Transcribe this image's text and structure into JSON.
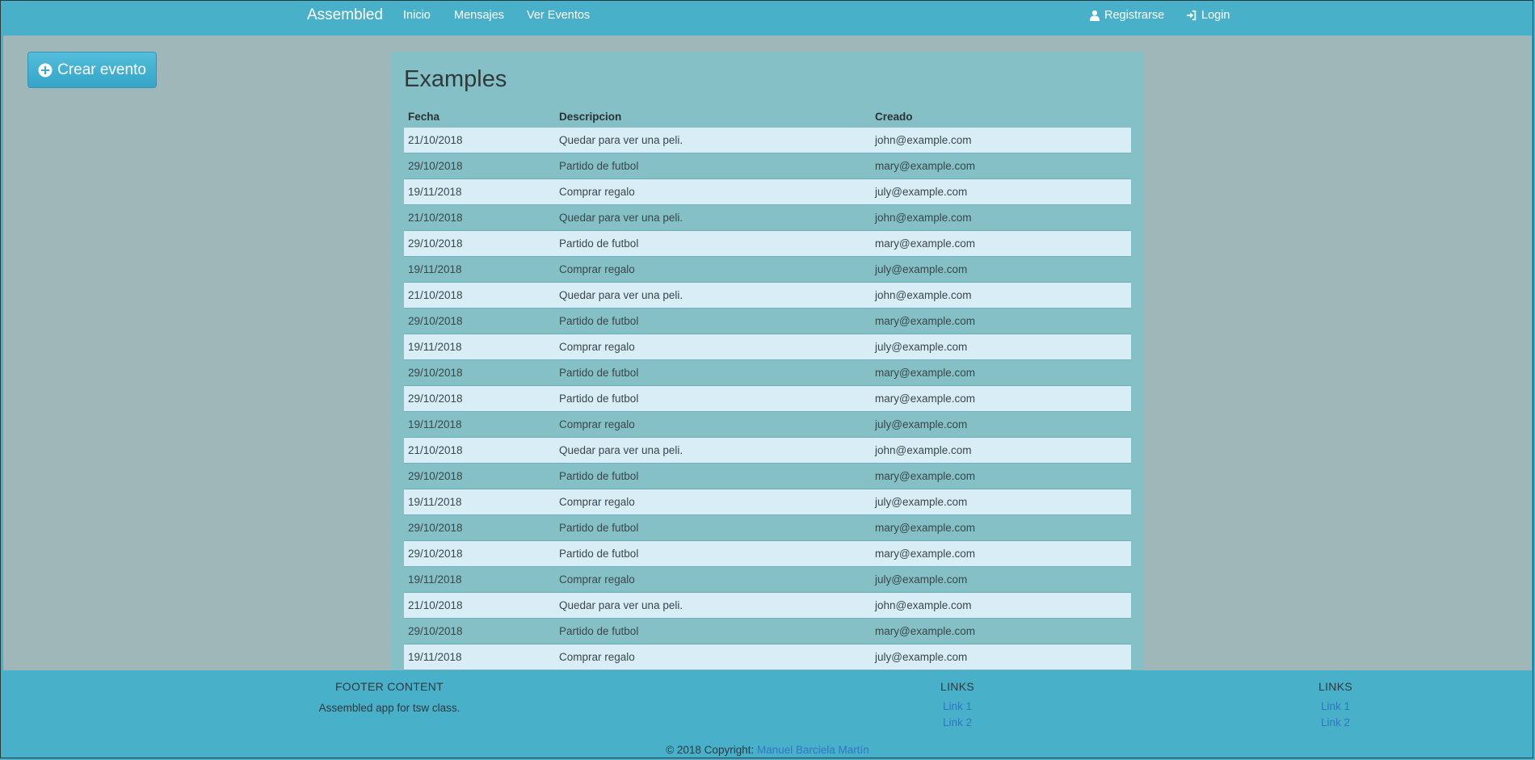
{
  "navbar": {
    "brand": "Assembled",
    "links": [
      "Inicio",
      "Mensajes",
      "Ver Eventos"
    ],
    "register_label": "Registrarse",
    "login_label": "Login"
  },
  "sidebar": {
    "create_button_label": "Crear evento"
  },
  "panel": {
    "title": "Examples",
    "columns": [
      "Fecha",
      "Descripcion",
      "Creado"
    ],
    "rows": [
      [
        "21/10/2018",
        "Quedar para ver una peli.",
        "john@example.com"
      ],
      [
        "29/10/2018",
        "Partido de futbol",
        "mary@example.com"
      ],
      [
        "19/11/2018",
        "Comprar regalo",
        "july@example.com"
      ],
      [
        "21/10/2018",
        "Quedar para ver una peli.",
        "john@example.com"
      ],
      [
        "29/10/2018",
        "Partido de futbol",
        "mary@example.com"
      ],
      [
        "19/11/2018",
        "Comprar regalo",
        "july@example.com"
      ],
      [
        "21/10/2018",
        "Quedar para ver una peli.",
        "john@example.com"
      ],
      [
        "29/10/2018",
        "Partido de futbol",
        "mary@example.com"
      ],
      [
        "19/11/2018",
        "Comprar regalo",
        "july@example.com"
      ],
      [
        "29/10/2018",
        "Partido de futbol",
        "mary@example.com"
      ],
      [
        "29/10/2018",
        "Partido de futbol",
        "mary@example.com"
      ],
      [
        "19/11/2018",
        "Comprar regalo",
        "july@example.com"
      ],
      [
        "21/10/2018",
        "Quedar para ver una peli.",
        "john@example.com"
      ],
      [
        "29/10/2018",
        "Partido de futbol",
        "mary@example.com"
      ],
      [
        "19/11/2018",
        "Comprar regalo",
        "july@example.com"
      ],
      [
        "29/10/2018",
        "Partido de futbol",
        "mary@example.com"
      ],
      [
        "29/10/2018",
        "Partido de futbol",
        "mary@example.com"
      ],
      [
        "19/11/2018",
        "Comprar regalo",
        "july@example.com"
      ],
      [
        "21/10/2018",
        "Quedar para ver una peli.",
        "john@example.com"
      ],
      [
        "29/10/2018",
        "Partido de futbol",
        "mary@example.com"
      ],
      [
        "19/11/2018",
        "Comprar regalo",
        "july@example.com"
      ]
    ]
  },
  "footer": {
    "content_heading": "FOOTER CONTENT",
    "content_text": "Assembled app for tsw class.",
    "links_heading_1": "LINKS",
    "links_1": [
      "Link 1",
      "Link 2"
    ],
    "links_heading_2": "LINKS",
    "links_2": [
      "Link 1",
      "Link 2"
    ],
    "copyright_prefix": "© 2018 Copyright:",
    "copyright_author": "Manuel Barciela Martín"
  },
  "colors": {
    "navbar_bg": "#48b0c9",
    "main_bg": "#9fb7b8",
    "panel_bg": "#84c0c5",
    "row_light": "#d9edf6",
    "link_blue": "#3276c2"
  },
  "icons": {
    "create_button": "plus-circle-icon",
    "register": "user-icon",
    "login": "login-icon"
  }
}
